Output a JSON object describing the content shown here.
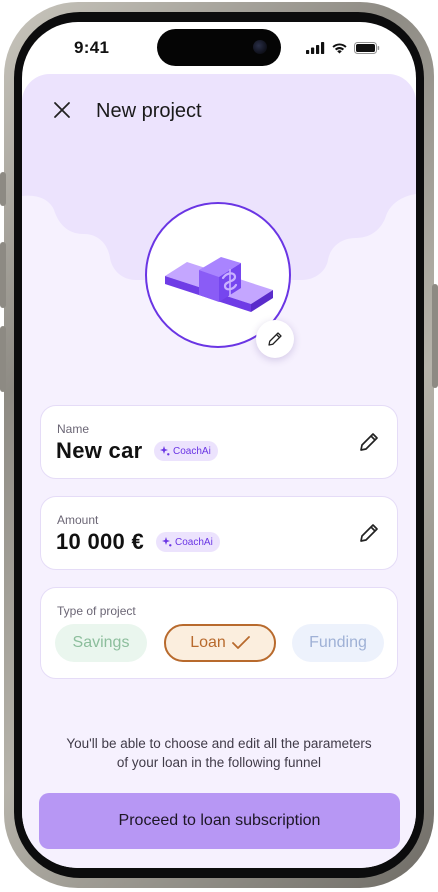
{
  "status_bar": {
    "time": "9:41"
  },
  "header": {
    "title": "New project"
  },
  "name_field": {
    "label": "Name",
    "value": "New car",
    "badge": "CoachAi"
  },
  "amount_field": {
    "label": "Amount",
    "value": "10 000 €",
    "badge": "CoachAi"
  },
  "project_type": {
    "label": "Type of project",
    "options": [
      {
        "label": "Savings",
        "selected": false,
        "color": "#8cbe9c"
      },
      {
        "label": "Loan",
        "selected": true,
        "color": "#b86a2d"
      },
      {
        "label": "Funding",
        "selected": false,
        "color": "#9fb1d6"
      }
    ]
  },
  "info_text": "You'll be able to choose and edit all the parameters of your loan in the following funnel",
  "cta": {
    "label": "Proceed to loan subscription"
  },
  "colors": {
    "accent": "#6a35e4",
    "sheet_bg": "#f6f1fe",
    "cta_bg": "#b797f4"
  },
  "icons": {
    "close": "close-icon",
    "edit": "pencil-icon",
    "ai": "sparkle-icon",
    "check": "check-icon",
    "illustration": "money-bill-icon"
  }
}
